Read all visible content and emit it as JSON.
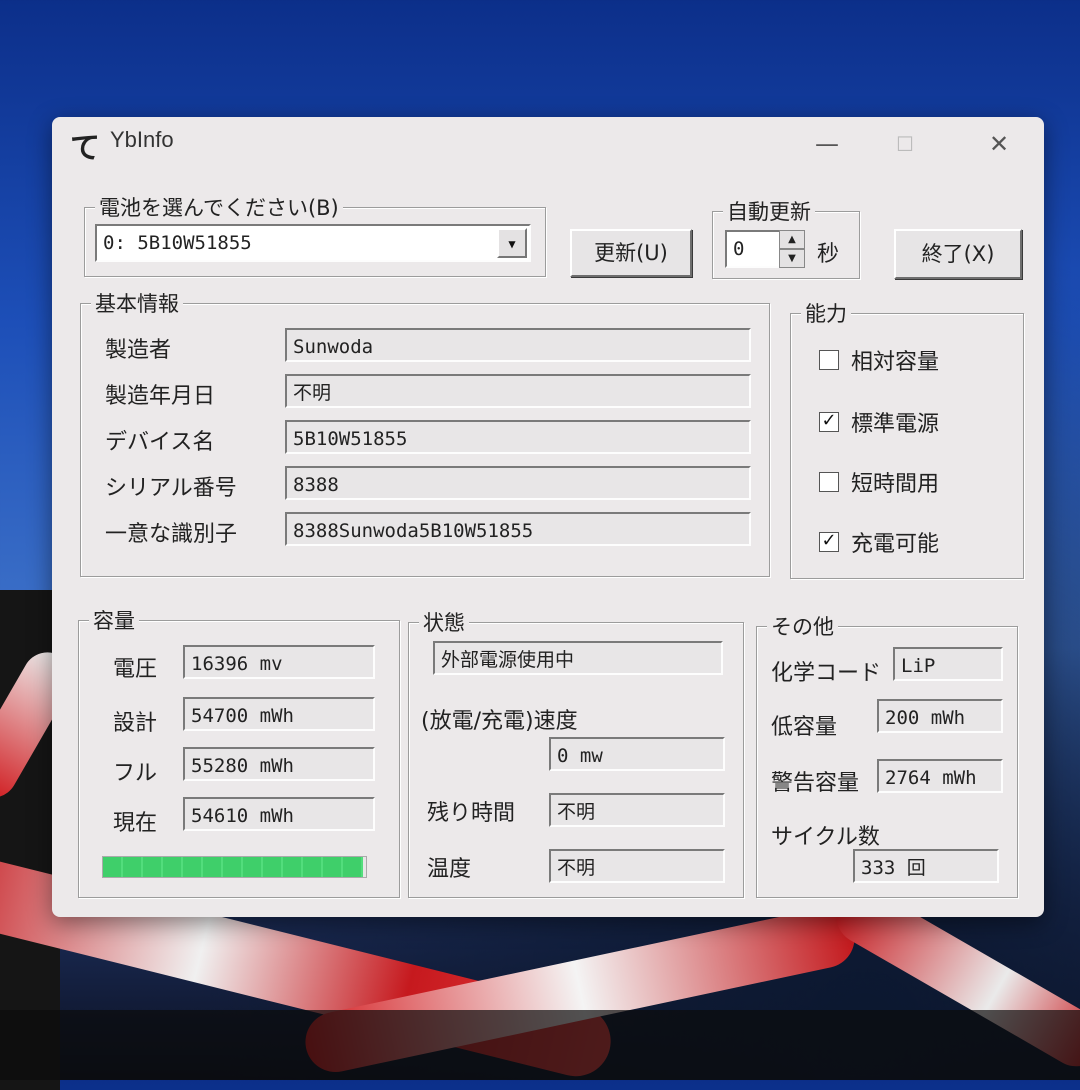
{
  "window": {
    "title": "YbInfo",
    "icon": "app-logo-icon"
  },
  "battery_select": {
    "label": "電池を選んでください(B)",
    "value": "0: 5B10W51855"
  },
  "buttons": {
    "update": "更新(U)",
    "exit": "終了(X)"
  },
  "auto_update": {
    "label": "自動更新",
    "value": "0",
    "unit": "秒"
  },
  "basic_info": {
    "label": "基本情報",
    "rows": [
      {
        "label": "製造者",
        "value": "Sunwoda"
      },
      {
        "label": "製造年月日",
        "value": "不明"
      },
      {
        "label": "デバイス名",
        "value": "5B10W51855"
      },
      {
        "label": "シリアル番号",
        "value": " 8388"
      },
      {
        "label": "一意な識別子",
        "value": " 8388Sunwoda5B10W51855"
      }
    ]
  },
  "capability": {
    "label": "能力",
    "items": [
      {
        "label": "相対容量",
        "checked": false,
        "mark": ""
      },
      {
        "label": "標準電源",
        "checked": true,
        "mark": "✓"
      },
      {
        "label": "短時間用",
        "checked": false,
        "mark": ""
      },
      {
        "label": "充電可能",
        "checked": true,
        "mark": "✓"
      }
    ]
  },
  "capacity": {
    "label": "容量",
    "rows": [
      {
        "label": "電圧",
        "value": "16396 mv"
      },
      {
        "label": "設計",
        "value": "54700 mWh"
      },
      {
        "label": "フル",
        "value": "55280 mWh"
      },
      {
        "label": "現在",
        "value": "54610 mWh"
      }
    ],
    "charge_fraction": 0.988,
    "bar_color": "#3fcf6a"
  },
  "status": {
    "label": "状態",
    "power": "外部電源使用中",
    "rate_label": "(放電/充電)速度",
    "rate_value": "0 mw",
    "remaining_label": "残り時間",
    "remaining_value": "不明",
    "temp_label": "温度",
    "temp_value": "不明"
  },
  "other": {
    "label": "その他",
    "chem_label": "化学コード",
    "chem_value": "LiP",
    "low_label": "低容量",
    "low_value": "200 mWh",
    "warn_label": "警告容量",
    "warn_value": "2764 mWh",
    "cycle_label": "サイクル数",
    "cycle_value": "333 回"
  }
}
